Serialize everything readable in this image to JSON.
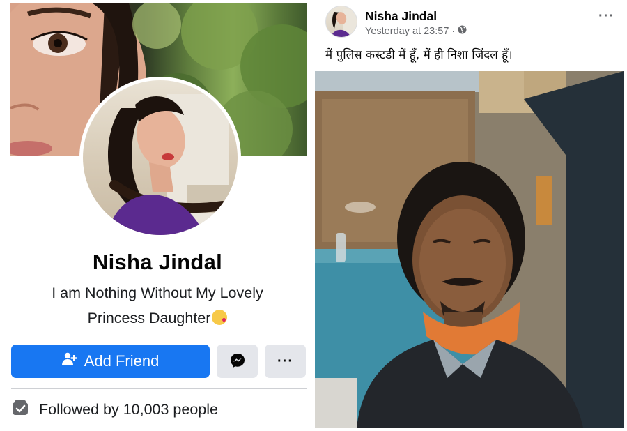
{
  "profile": {
    "name": "Nisha Jindal",
    "bio_line1": "I am Nothing Without My Lovely",
    "bio_line2": "Princess Daughter",
    "add_friend_label": "Add Friend",
    "more_label": "···",
    "followers_text": "Followed by 10,003 people"
  },
  "post": {
    "author": "Nisha Jindal",
    "timestamp": "Yesterday at 23:57",
    "separator": "·",
    "options_label": "···",
    "text": "मैं पुलिस कस्टडी में हूँ, मैं ही निशा जिंदल हूँ।"
  },
  "icons": {
    "add_friend": "person-plus-icon",
    "messenger": "messenger-icon",
    "audience": "globe-icon",
    "followers": "followers-icon",
    "emoji": "kissing-face-emoji"
  },
  "colors": {
    "primary": "#1877f2",
    "button_gray": "#e4e6eb",
    "secondary_text": "#65676b"
  }
}
